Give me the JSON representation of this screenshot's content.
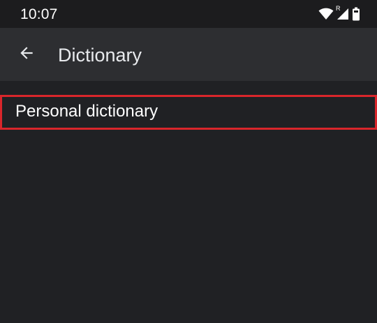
{
  "status_bar": {
    "time": "10:07",
    "icons": [
      "wifi-icon",
      "signal-icon",
      "battery-icon"
    ],
    "signal_badge": "R"
  },
  "app_bar": {
    "back_icon": "arrow-left-icon",
    "title": "Dictionary"
  },
  "list": {
    "items": [
      {
        "label": "Personal dictionary"
      }
    ]
  },
  "colors": {
    "background": "#202124",
    "status_bar": "#1c1c1e",
    "app_bar": "#2d2e31",
    "highlight": "#d9262b",
    "text": "#ffffff"
  }
}
